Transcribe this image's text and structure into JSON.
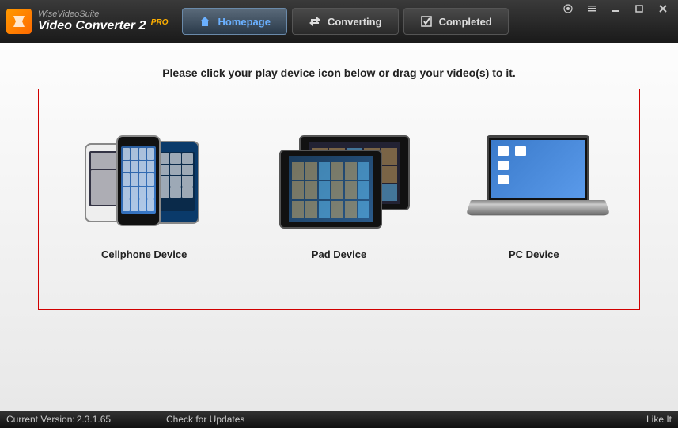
{
  "app": {
    "brand": "WiseVideoSuite",
    "title": "Video Converter 2",
    "badge": "PRO"
  },
  "tabs": {
    "homepage": "Homepage",
    "converting": "Converting",
    "completed": "Completed"
  },
  "main": {
    "instruction": "Please click your play device icon below or drag your video(s) to it."
  },
  "devices": {
    "cellphone": "Cellphone Device",
    "pad": "Pad Device",
    "pc": "PC Device"
  },
  "status": {
    "version_label": "Current Version:",
    "version_value": "2.3.1.65",
    "check_updates": "Check for Updates",
    "like": "Like It"
  }
}
